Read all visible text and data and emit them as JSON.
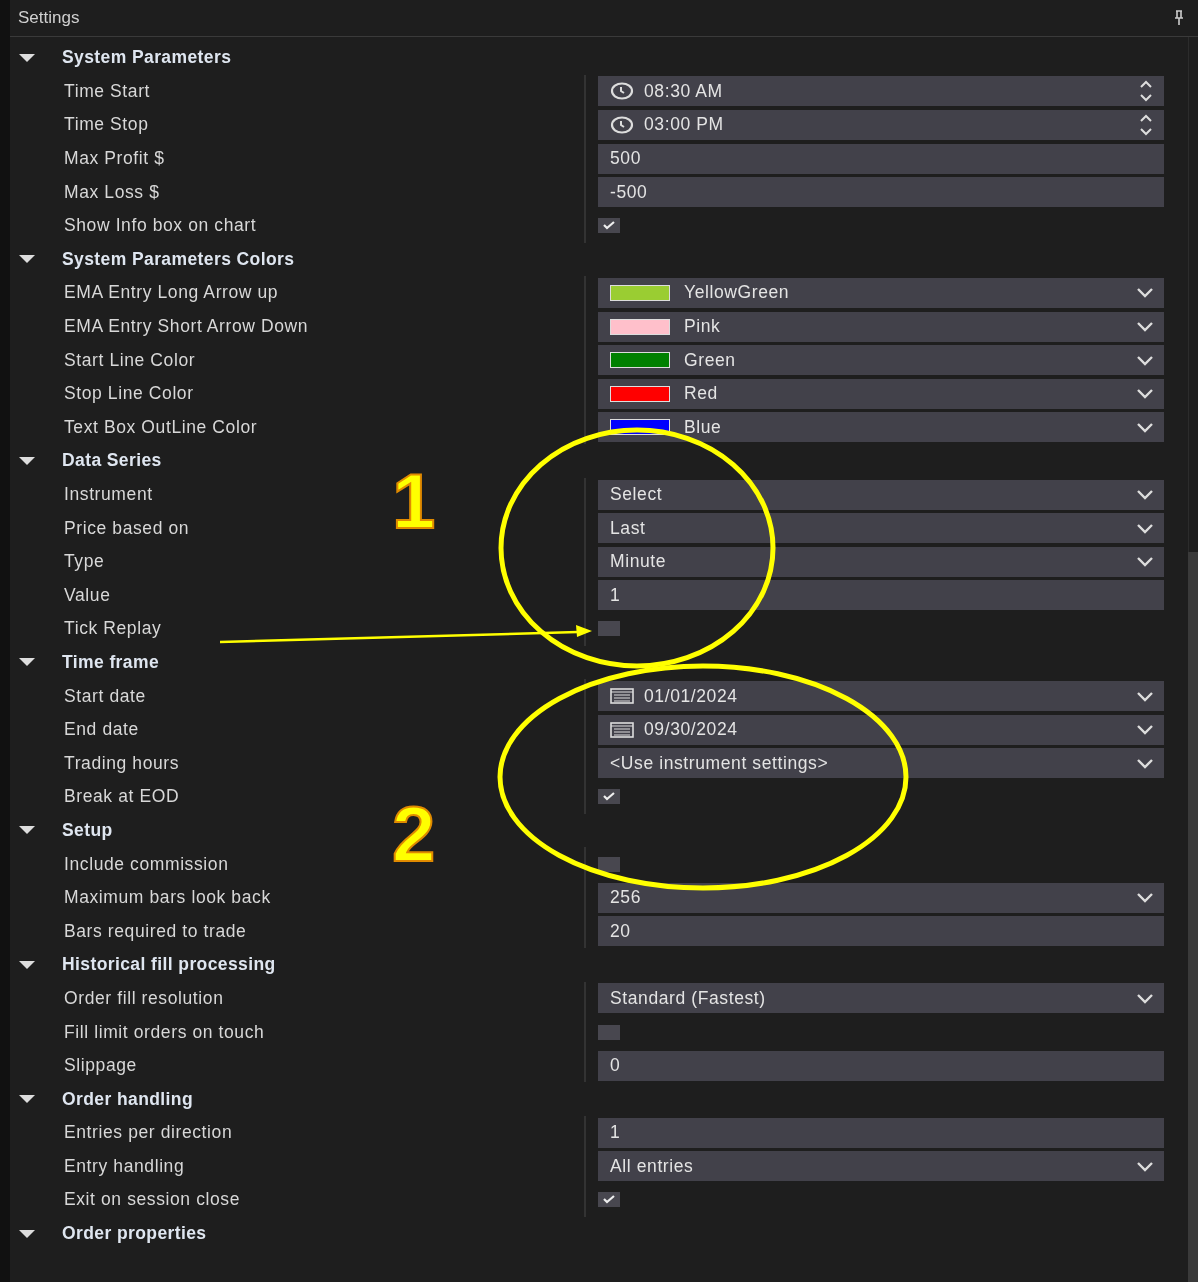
{
  "window": {
    "title": "Settings"
  },
  "sections": [
    {
      "title": "System Parameters",
      "expanded": true,
      "rows": [
        {
          "label": "Time Start",
          "kind": "time",
          "value": "08:30 AM"
        },
        {
          "label": "Time Stop",
          "kind": "time",
          "value": "03:00 PM"
        },
        {
          "label": "Max Profit $",
          "kind": "text",
          "value": "500"
        },
        {
          "label": "Max Loss $",
          "kind": "text",
          "value": "-500"
        },
        {
          "label": "Show Info box on chart",
          "kind": "checkbox",
          "checked": true
        }
      ]
    },
    {
      "title": "System Parameters Colors",
      "expanded": true,
      "rows": [
        {
          "label": "EMA Entry Long Arrow up",
          "kind": "color",
          "value": "YellowGreen",
          "color": "#9acd32"
        },
        {
          "label": "EMA Entry Short Arrow Down",
          "kind": "color",
          "value": "Pink",
          "color": "#ffc0cb"
        },
        {
          "label": "Start Line Color",
          "kind": "color",
          "value": "Green",
          "color": "#008000"
        },
        {
          "label": "Stop Line Color",
          "kind": "color",
          "value": "Red",
          "color": "#ff0000"
        },
        {
          "label": "Text Box OutLine Color",
          "kind": "color",
          "value": "Blue",
          "color": "#0000ff"
        }
      ]
    },
    {
      "title": "Data Series",
      "expanded": true,
      "rows": [
        {
          "label": "Instrument",
          "kind": "dropdown",
          "value": "Select"
        },
        {
          "label": "Price based on",
          "kind": "dropdown",
          "value": "Last"
        },
        {
          "label": "Type",
          "kind": "dropdown",
          "value": "Minute"
        },
        {
          "label": "Value",
          "kind": "text",
          "value": "1"
        },
        {
          "label": "Tick Replay",
          "kind": "checkbox",
          "checked": false
        }
      ]
    },
    {
      "title": "Time frame",
      "expanded": true,
      "rows": [
        {
          "label": "Start date",
          "kind": "date",
          "value": "01/01/2024"
        },
        {
          "label": "End date",
          "kind": "date",
          "value": "09/30/2024"
        },
        {
          "label": "Trading hours",
          "kind": "dropdown",
          "value": "<Use instrument settings>"
        },
        {
          "label": "Break at EOD",
          "kind": "checkbox",
          "checked": true
        }
      ]
    },
    {
      "title": "Setup",
      "expanded": true,
      "rows": [
        {
          "label": "Include commission",
          "kind": "checkbox",
          "checked": false
        },
        {
          "label": "Maximum bars look back",
          "kind": "dropdown",
          "value": "256"
        },
        {
          "label": "Bars required to trade",
          "kind": "text",
          "value": "20"
        }
      ]
    },
    {
      "title": "Historical fill processing",
      "expanded": true,
      "rows": [
        {
          "label": "Order fill resolution",
          "kind": "dropdown",
          "value": "Standard (Fastest)"
        },
        {
          "label": "Fill limit orders on touch",
          "kind": "checkbox",
          "checked": false
        },
        {
          "label": "Slippage",
          "kind": "text",
          "value": "0"
        }
      ]
    },
    {
      "title": "Order handling",
      "expanded": true,
      "rows": [
        {
          "label": "Entries per direction",
          "kind": "text",
          "value": "1"
        },
        {
          "label": "Entry handling",
          "kind": "dropdown",
          "value": "All entries"
        },
        {
          "label": "Exit on session close",
          "kind": "checkbox",
          "checked": true
        }
      ]
    },
    {
      "title": "Order properties",
      "expanded": true
    }
  ],
  "annotations": [
    {
      "number": "1"
    },
    {
      "number": "2"
    }
  ]
}
